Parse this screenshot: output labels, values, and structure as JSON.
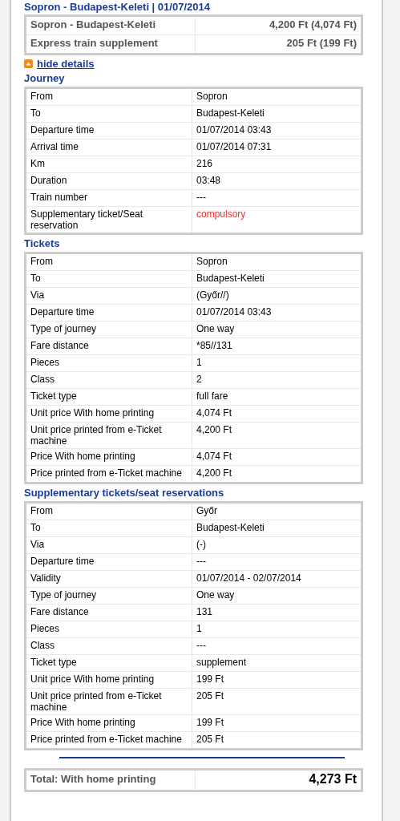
{
  "header": "Sopron - Budapest-Keleti | 01/07/2014",
  "summary": [
    {
      "label": "Sopron - Budapest-Keleti",
      "price": "4,200 Ft (4,074 Ft)"
    },
    {
      "label": "Express train supplement",
      "price": "205 Ft (199 Ft)"
    }
  ],
  "toggle_link": "hide details",
  "sections": [
    {
      "title": "Journey",
      "rows": [
        {
          "label": "From",
          "value": "Sopron",
          "emphasis": false
        },
        {
          "label": "To",
          "value": "Budapest-Keleti",
          "emphasis": false
        },
        {
          "label": "Departure time",
          "value": "01/07/2014 03:43",
          "emphasis": false
        },
        {
          "label": "Arrival time",
          "value": "01/07/2014 07:31",
          "emphasis": false
        },
        {
          "label": "Km",
          "value": "216",
          "emphasis": false
        },
        {
          "label": "Duration",
          "value": "03:48",
          "emphasis": false
        },
        {
          "label": "Train number",
          "value": "---",
          "emphasis": false
        },
        {
          "label": "Supplementary ticket/Seat reservation",
          "value": "compulsory",
          "emphasis": true
        }
      ]
    },
    {
      "title": "Tickets",
      "rows": [
        {
          "label": "From",
          "value": "Sopron",
          "emphasis": false
        },
        {
          "label": "To",
          "value": "Budapest-Keleti",
          "emphasis": false
        },
        {
          "label": "Via",
          "value": "(Győr//)",
          "emphasis": false
        },
        {
          "label": "Departure time",
          "value": "01/07/2014 03:43",
          "emphasis": false
        },
        {
          "label": "Type of journey",
          "value": "One way",
          "emphasis": false
        },
        {
          "label": "Fare distance",
          "value": "*85//131",
          "emphasis": false
        },
        {
          "label": "Pieces",
          "value": "1",
          "emphasis": false
        },
        {
          "label": "Class",
          "value": "2",
          "emphasis": false
        },
        {
          "label": "Ticket type",
          "value": "full fare",
          "emphasis": false
        },
        {
          "label": "Unit price With home printing",
          "value": "4,074 Ft",
          "emphasis": false
        },
        {
          "label": "Unit price printed from e-Ticket machine",
          "value": "4,200 Ft",
          "emphasis": false
        },
        {
          "label": "Price With home printing",
          "value": "4,074 Ft",
          "emphasis": false
        },
        {
          "label": "Price printed from e-Ticket machine",
          "value": "4,200 Ft",
          "emphasis": false
        }
      ]
    },
    {
      "title": "Supplementary tickets/seat reservations",
      "rows": [
        {
          "label": "From",
          "value": "Győr",
          "emphasis": false
        },
        {
          "label": "To",
          "value": "Budapest-Keleti",
          "emphasis": false
        },
        {
          "label": "Via",
          "value": "(-)",
          "emphasis": false
        },
        {
          "label": "Departure time",
          "value": "---",
          "emphasis": false
        },
        {
          "label": "Validity",
          "value": "01/07/2014 - 02/07/2014",
          "emphasis": false
        },
        {
          "label": "Type of journey",
          "value": "One way",
          "emphasis": false
        },
        {
          "label": "Fare distance",
          "value": "131",
          "emphasis": false
        },
        {
          "label": "Pieces",
          "value": "1",
          "emphasis": false
        },
        {
          "label": "Class",
          "value": "---",
          "emphasis": false
        },
        {
          "label": "Ticket type",
          "value": "supplement",
          "emphasis": false
        },
        {
          "label": "Unit price With home printing",
          "value": "199 Ft",
          "emphasis": false
        },
        {
          "label": "Unit price printed from e-Ticket machine",
          "value": "205 Ft",
          "emphasis": false
        },
        {
          "label": "Price With home printing",
          "value": "199 Ft",
          "emphasis": false
        },
        {
          "label": "Price printed from e-Ticket machine",
          "value": "205 Ft",
          "emphasis": false
        }
      ]
    }
  ],
  "total": {
    "label": "Total: With home printing",
    "value": "4,273 Ft"
  }
}
